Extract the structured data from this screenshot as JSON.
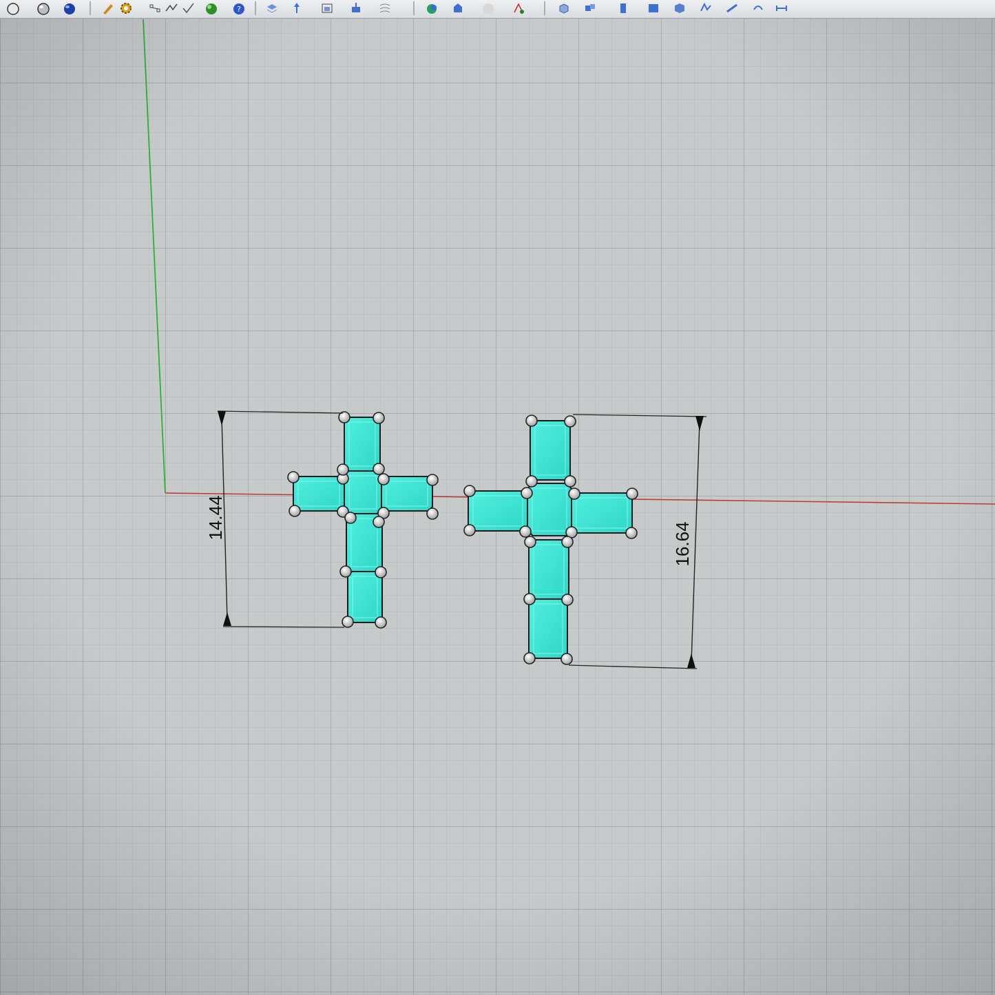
{
  "app": {
    "viewport": "Top"
  },
  "toolbar": {
    "buttons": [
      {
        "id": "shaded-sphere",
        "icon": "shaded-sphere-icon"
      },
      {
        "id": "rendered-sphere",
        "icon": "rendered-sphere-icon"
      },
      {
        "id": "material-sphere",
        "icon": "blue-sphere-icon"
      },
      {
        "id": "options",
        "icon": "gear-icon"
      },
      {
        "id": "control-points",
        "icon": "control-points-icon"
      },
      {
        "id": "polyline",
        "icon": "polyline-icon"
      },
      {
        "id": "render",
        "icon": "green-globe-icon"
      },
      {
        "id": "help",
        "icon": "help-icon"
      },
      {
        "id": "layer",
        "icon": "layer-icon"
      },
      {
        "id": "move",
        "icon": "move-icon"
      },
      {
        "id": "align",
        "icon": "align-icon"
      },
      {
        "id": "array",
        "icon": "array-icon"
      },
      {
        "id": "map",
        "icon": "map-icon"
      },
      {
        "id": "boolean",
        "icon": "boolean-icon"
      },
      {
        "id": "sphere-grey",
        "icon": "grey-sphere-icon"
      },
      {
        "id": "analyze",
        "icon": "analyze-icon"
      },
      {
        "id": "solid-box",
        "icon": "solid-box-icon"
      },
      {
        "id": "solid-tools",
        "icon": "solid-tools-icon"
      },
      {
        "id": "extrude",
        "icon": "extrude-icon"
      },
      {
        "id": "blocks",
        "icon": "blocks-icon"
      },
      {
        "id": "transform",
        "icon": "transform-icon"
      },
      {
        "id": "mesh",
        "icon": "mesh-icon"
      },
      {
        "id": "dimension",
        "icon": "dimension-icon"
      }
    ]
  },
  "dimensions": [
    {
      "name": "left-cross-height",
      "value": "14.44"
    },
    {
      "name": "right-cross-height",
      "value": "16.64"
    }
  ],
  "colors": {
    "grid_background": "#c7cacb",
    "grid_minor": "#b6b9bb",
    "grid_major": "#9ea2a5",
    "x_axis": "#c0393b",
    "y_axis": "#2fae3a",
    "stone_fill": "#3fe3d3",
    "stone_edge": "#1a1a1a",
    "prong": "#d9d9d9"
  }
}
